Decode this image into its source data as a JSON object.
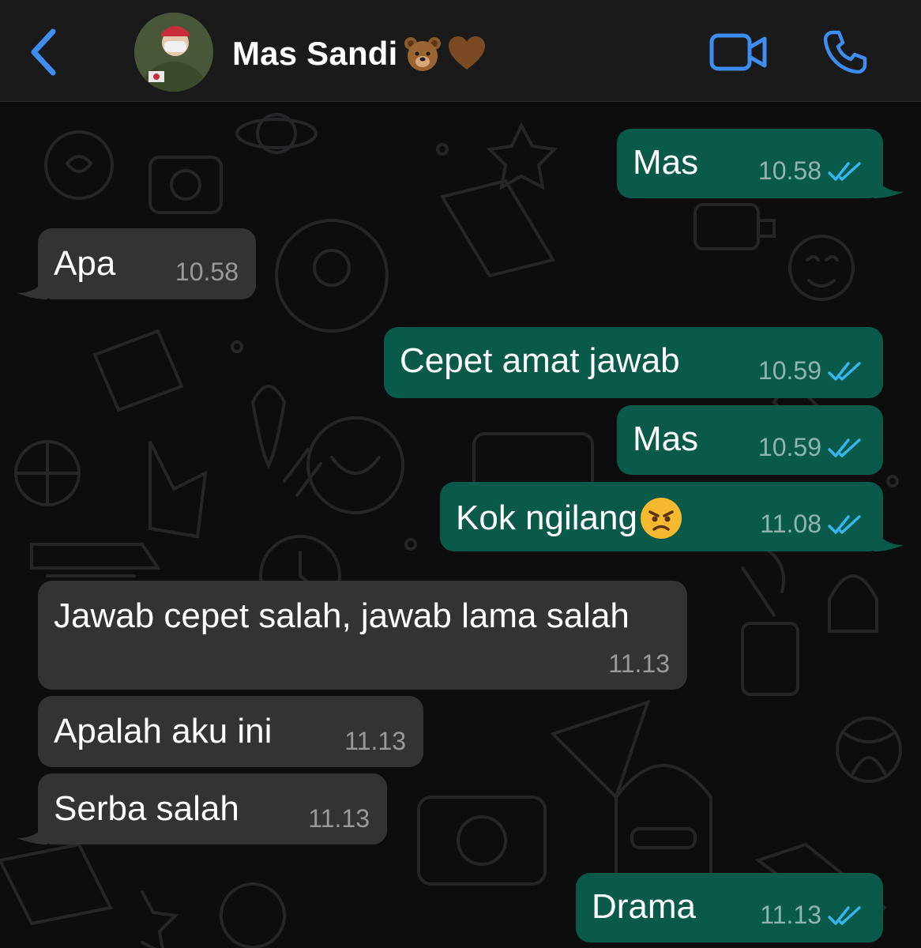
{
  "header": {
    "contact_name": "Mas Sandi",
    "name_emojis": [
      "bear-emoji",
      "brown-heart-emoji"
    ],
    "back_icon": "chevron-left-icon",
    "video_icon": "video-camera-icon",
    "call_icon": "phone-icon"
  },
  "colors": {
    "accent": "#3d8ef0",
    "outgoing_bubble": "#0a5a4a",
    "incoming_bubble": "#333335",
    "read_tick": "#34b7f1"
  },
  "messages": [
    {
      "direction": "outgoing",
      "text": "Mas",
      "time": "10.58",
      "status": "read"
    },
    {
      "direction": "incoming",
      "text": "Apa",
      "time": "10.58"
    },
    {
      "direction": "outgoing",
      "text": "Cepet amat jawab",
      "time": "10.59",
      "status": "read"
    },
    {
      "direction": "outgoing",
      "text": "Mas",
      "time": "10.59",
      "status": "read"
    },
    {
      "direction": "outgoing",
      "text": "Kok ngilang",
      "emoji": "angry-face-emoji",
      "time": "11.08",
      "status": "read"
    },
    {
      "direction": "incoming",
      "text": "Jawab cepet salah, jawab lama salah",
      "time": "11.13"
    },
    {
      "direction": "incoming",
      "text": "Apalah aku ini",
      "time": "11.13"
    },
    {
      "direction": "incoming",
      "text": "Serba salah",
      "time": "11.13"
    },
    {
      "direction": "outgoing",
      "text": "Drama",
      "time": "11.13",
      "status": "read"
    }
  ]
}
